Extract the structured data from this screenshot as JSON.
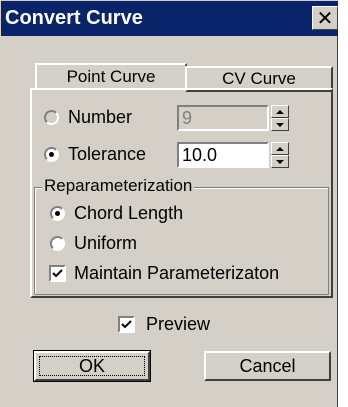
{
  "window": {
    "title": "Convert Curve",
    "close_glyph": "✕"
  },
  "tabs": [
    {
      "label": "Point Curve",
      "active": true
    },
    {
      "label": "CV Curve",
      "active": false
    }
  ],
  "options": {
    "number": {
      "label": "Number",
      "selected": false,
      "value": "9",
      "enabled": false
    },
    "tolerance": {
      "label": "Tolerance",
      "selected": true,
      "value": "10.0",
      "enabled": true
    }
  },
  "reparam": {
    "legend": "Reparameterization",
    "chord_length": {
      "label": "Chord Length",
      "selected": true
    },
    "uniform": {
      "label": "Uniform",
      "selected": false
    },
    "maintain": {
      "label": "Maintain Parameterizaton",
      "checked": true
    }
  },
  "preview": {
    "label": "Preview",
    "checked": true
  },
  "buttons": {
    "ok": "OK",
    "cancel": "Cancel"
  },
  "colors": {
    "titlebar": "#0a246a",
    "face": "#d4d0c8",
    "disabled_text": "#808080"
  }
}
